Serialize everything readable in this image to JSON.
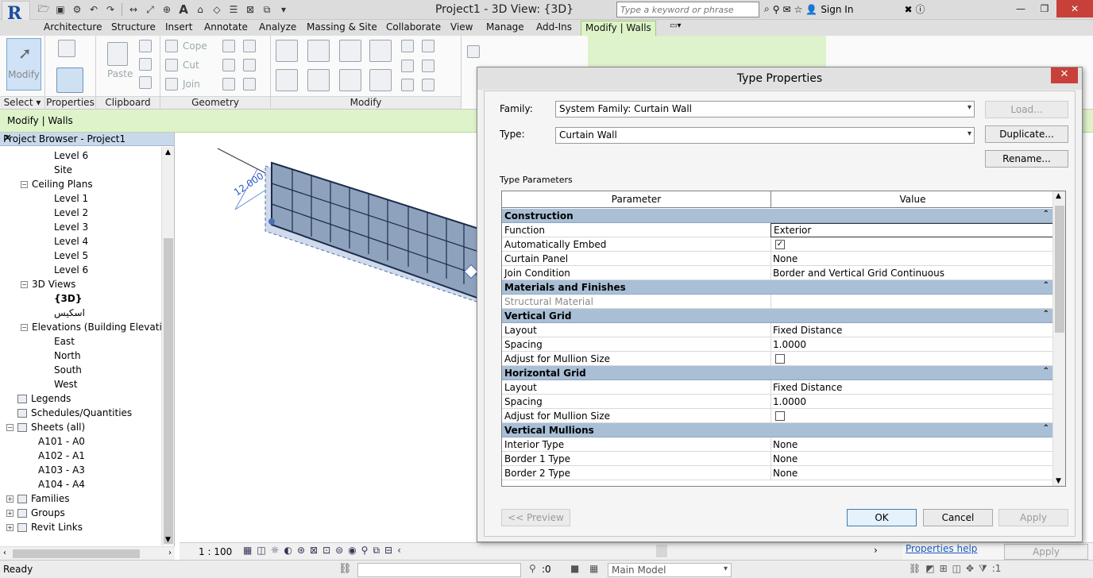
{
  "app": {
    "document_title": "Project1 - 3D View: {3D}",
    "search_placeholder": "Type a keyword or phrase",
    "sign_in": "Sign In",
    "app_letter": "A"
  },
  "ribbon": {
    "tabs": [
      "Architecture",
      "Structure",
      "Insert",
      "Annotate",
      "Analyze",
      "Massing & Site",
      "Collaborate",
      "View",
      "Manage",
      "Add-Ins",
      "Modify | Walls"
    ],
    "active_tab": "Modify | Walls",
    "modify_label": "Modify",
    "panels": [
      "Select",
      "Properties",
      "Clipboard",
      "Geometry",
      "Modify"
    ],
    "select_label": "Select",
    "paste_label": "Paste",
    "cope_label": "Cope",
    "cut_label": "Cut",
    "join_label": "Join"
  },
  "options_bar": {
    "context": "Modify | Walls"
  },
  "project_browser": {
    "title": "Project Browser - Project1",
    "nodes": [
      {
        "label": "Level 6"
      },
      {
        "label": "Site"
      },
      {
        "label": "Ceiling Plans"
      },
      {
        "label": "Level 1"
      },
      {
        "label": "Level 2"
      },
      {
        "label": "Level 3"
      },
      {
        "label": "Level 4"
      },
      {
        "label": "Level 5"
      },
      {
        "label": "Level 6"
      },
      {
        "label": "3D Views"
      },
      {
        "label": "{3D}"
      },
      {
        "label": "اسكيس"
      },
      {
        "label": "Elevations (Building Elevation"
      },
      {
        "label": "East"
      },
      {
        "label": "North"
      },
      {
        "label": "South"
      },
      {
        "label": "West"
      },
      {
        "label": "Legends"
      },
      {
        "label": "Schedules/Quantities"
      },
      {
        "label": "Sheets (all)"
      },
      {
        "label": "A101 - A0"
      },
      {
        "label": "A102 - A1"
      },
      {
        "label": "A103 - A3"
      },
      {
        "label": "A104 - A4"
      },
      {
        "label": "Families"
      },
      {
        "label": "Groups"
      },
      {
        "label": "Revit Links"
      }
    ]
  },
  "view": {
    "dimension": "12.000",
    "scale": "1 : 100"
  },
  "dialog": {
    "title": "Type Properties",
    "family_label": "Family:",
    "family_value": "System Family: Curtain Wall",
    "type_label": "Type:",
    "type_value": "Curtain Wall",
    "load_button": "Load...",
    "duplicate_button": "Duplicate...",
    "rename_button": "Rename...",
    "section_label": "Type Parameters",
    "col_parameter": "Parameter",
    "col_value": "Value",
    "rows": [
      {
        "kind": "group",
        "param": "Construction"
      },
      {
        "kind": "row",
        "param": "Function",
        "value": "Exterior",
        "editing": true
      },
      {
        "kind": "check",
        "param": "Automatically Embed",
        "checked": true
      },
      {
        "kind": "row",
        "param": "Curtain Panel",
        "value": "None"
      },
      {
        "kind": "row",
        "param": "Join Condition",
        "value": "Border and Vertical Grid Continuous"
      },
      {
        "kind": "group",
        "param": "Materials and Finishes"
      },
      {
        "kind": "disabled",
        "param": "Structural Material",
        "value": ""
      },
      {
        "kind": "group",
        "param": "Vertical Grid"
      },
      {
        "kind": "row",
        "param": "Layout",
        "value": "Fixed Distance"
      },
      {
        "kind": "row",
        "param": "Spacing",
        "value": "1.0000"
      },
      {
        "kind": "check",
        "param": "Adjust for Mullion Size",
        "checked": false
      },
      {
        "kind": "group",
        "param": "Horizontal Grid"
      },
      {
        "kind": "row",
        "param": "Layout",
        "value": "Fixed Distance"
      },
      {
        "kind": "row",
        "param": "Spacing",
        "value": "1.0000"
      },
      {
        "kind": "check",
        "param": "Adjust for Mullion Size",
        "checked": false
      },
      {
        "kind": "group",
        "param": "Vertical Mullions"
      },
      {
        "kind": "row",
        "param": "Interior Type",
        "value": "None"
      },
      {
        "kind": "row",
        "param": "Border 1 Type",
        "value": "None"
      },
      {
        "kind": "row",
        "param": "Border 2 Type",
        "value": "None"
      }
    ],
    "preview_button": "<< Preview",
    "ok_button": "OK",
    "cancel_button": "Cancel",
    "apply_button": "Apply"
  },
  "properties_help": {
    "link": "Properties help",
    "apply": "Apply"
  },
  "status": {
    "ready": "Ready",
    "selection_count": ":0",
    "model": "Main Model",
    "filter_count": ":1"
  },
  "colors": {
    "accent_green": "#ddf3c8",
    "group_row": "#a9bfd6",
    "close_red": "#c7413a",
    "wall_fill": "#8ea2bd"
  }
}
